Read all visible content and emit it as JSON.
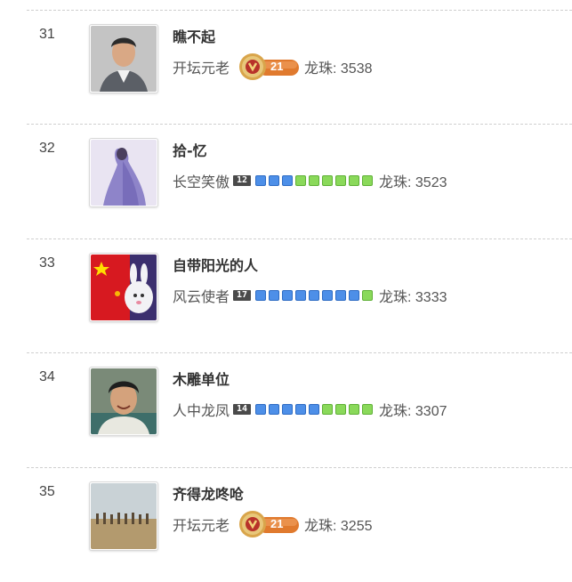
{
  "entries": [
    {
      "rank": "31",
      "name": "瞧不起",
      "title": "开坛元老",
      "badge": {
        "type": "medal",
        "level": "21"
      },
      "pearls": "龙珠: 3538",
      "avatar": "avatar-1"
    },
    {
      "rank": "32",
      "name": "拾-忆",
      "title": "长空笑傲",
      "badge": {
        "type": "blocks",
        "level": "12",
        "blocks": [
          "blue",
          "blue",
          "blue",
          "green",
          "green",
          "green",
          "green",
          "green",
          "green"
        ]
      },
      "pearls": "龙珠: 3523",
      "avatar": "avatar-2"
    },
    {
      "rank": "33",
      "name": "自带阳光的人",
      "title": "风云使者",
      "badge": {
        "type": "blocks",
        "level": "17",
        "blocks": [
          "blue",
          "blue",
          "blue",
          "blue",
          "blue",
          "blue",
          "blue",
          "blue",
          "green"
        ]
      },
      "pearls": "龙珠: 3333",
      "avatar": "avatar-3"
    },
    {
      "rank": "34",
      "name": "木雕单位",
      "title": "人中龙凤",
      "badge": {
        "type": "blocks",
        "level": "14",
        "blocks": [
          "blue",
          "blue",
          "blue",
          "blue",
          "blue",
          "green",
          "green",
          "green",
          "green"
        ]
      },
      "pearls": "龙珠: 3307",
      "avatar": "avatar-4"
    },
    {
      "rank": "35",
      "name": "齐得龙咚呛",
      "title": "开坛元老",
      "badge": {
        "type": "medal",
        "level": "21"
      },
      "pearls": "龙珠: 3255",
      "avatar": "avatar-5"
    }
  ],
  "colors": {
    "block_blue": "#4d8fe8",
    "block_green": "#8ad95a",
    "medal_orange": "#e07a2e",
    "divider": "#cfcfcf"
  }
}
